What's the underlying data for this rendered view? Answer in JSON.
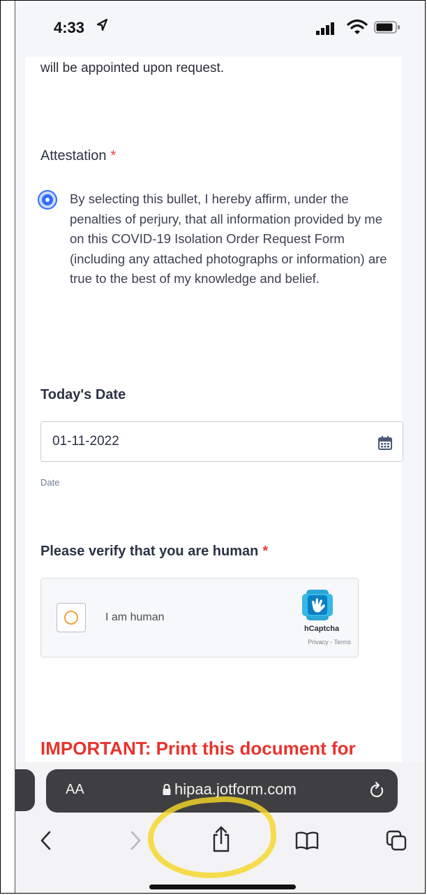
{
  "status_bar": {
    "time": "4:33"
  },
  "form": {
    "cut_text": "will be appointed upon request.",
    "attestation": {
      "label": "Attestation",
      "required_mark": "*",
      "statement": "By selecting this bullet, I hereby affirm, under the penalties of perjury, that all information provided by me on this COVID-19 Isolation Order Request Form (including any attached photographs or information) are true to the best of my knowledge and belief.",
      "selected": true
    },
    "date": {
      "label": "Today's Date",
      "value": "01-11-2022",
      "sublabel": "Date"
    },
    "verify": {
      "label": "Please verify that you are human",
      "required_mark": "*",
      "checkbox_label": "I am human",
      "brand": "hCaptcha",
      "links": "Privacy - Terms"
    },
    "important": "IMPORTANT: Print this document for"
  },
  "browser": {
    "aa_label": "AA",
    "domain": "hipaa.jotform.com",
    "toolbar_icons": [
      "back-icon",
      "forward-icon",
      "share-icon",
      "bookmarks-icon",
      "tabs-icon"
    ]
  },
  "colors": {
    "required": "#e0413b",
    "radio_selected": "#2f6ef5",
    "important_text": "#e8332d",
    "url_bar": "#3f3f41",
    "annotation_highlight": "#f5d728"
  }
}
